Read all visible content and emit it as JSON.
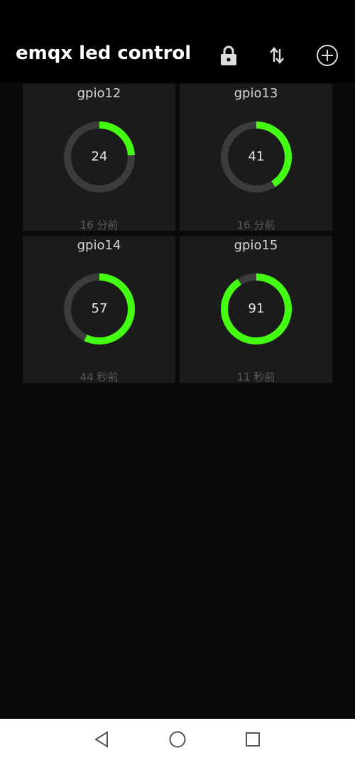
{
  "app": {
    "title": "emqx led control"
  },
  "toolbar": {
    "lock_icon": "lock-icon",
    "sort_icon": "swap-vertical-icon",
    "add_icon": "add-circle-icon"
  },
  "colors": {
    "accent": "#44ff11",
    "track": "#3c3c3c",
    "tile_bg": "#1b1b1b",
    "page_bg": "#0a0a0a",
    "appbar_bg": "#000000"
  },
  "devices": [
    {
      "name": "gpio12",
      "value": "24",
      "percent": 24,
      "updated": "16 分前"
    },
    {
      "name": "gpio13",
      "value": "41",
      "percent": 41,
      "updated": "16 分前"
    },
    {
      "name": "gpio14",
      "value": "57",
      "percent": 57,
      "updated": "44 秒前"
    },
    {
      "name": "gpio15",
      "value": "91",
      "percent": 91,
      "updated": "11 秒前"
    }
  ],
  "navbar": {
    "back_icon": "back-triangle-icon",
    "home_icon": "home-circle-icon",
    "recents_icon": "recents-square-icon"
  }
}
